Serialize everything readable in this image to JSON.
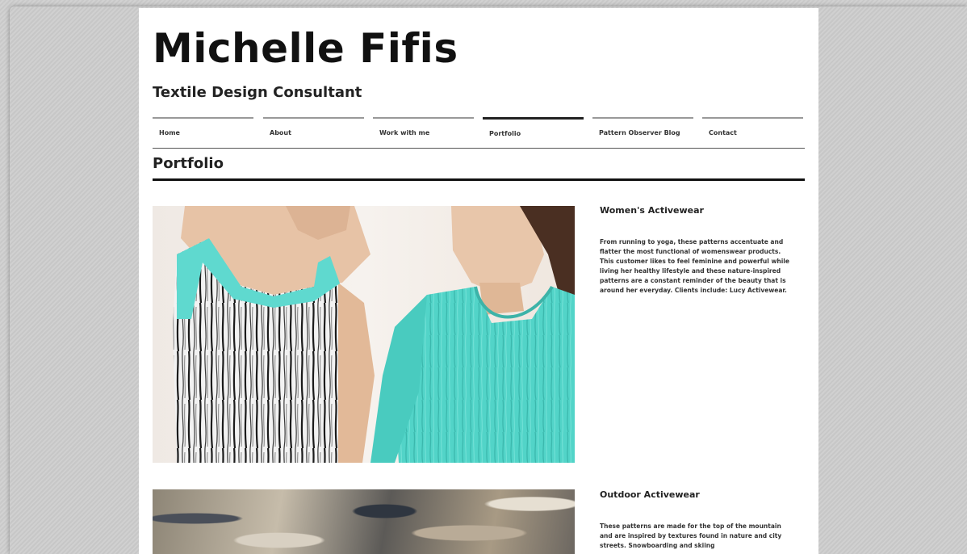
{
  "site": {
    "title": "Michelle Fifis",
    "tagline": "Textile Design Consultant"
  },
  "nav": {
    "items": [
      {
        "label": "Home"
      },
      {
        "label": "About"
      },
      {
        "label": "Work with me"
      },
      {
        "label": "Portfolio"
      },
      {
        "label": "Pattern Observer Blog"
      },
      {
        "label": "Contact"
      }
    ],
    "active": "Portfolio"
  },
  "page_title": "Portfolio",
  "portfolio": [
    {
      "title": "Women's Activewear",
      "description": "From running to yoga, these patterns accentuate and flatter the most functional of womenswear products. This customer likes to feel feminine and powerful while living her healthy lifestyle and these nature-inspired patterns are a constant reminder of the beauty that is around her everyday. Clients include: Lucy Activewear."
    },
    {
      "title": "Outdoor Activewear",
      "description": "These patterns are made for the top of the mountain and are inspired by textures found in nature and city streets. Snowboarding and skiing"
    }
  ],
  "colors": {
    "accent_teal": "#5fd9cf",
    "text": "#222222",
    "background_stripe": "#cccccc"
  }
}
